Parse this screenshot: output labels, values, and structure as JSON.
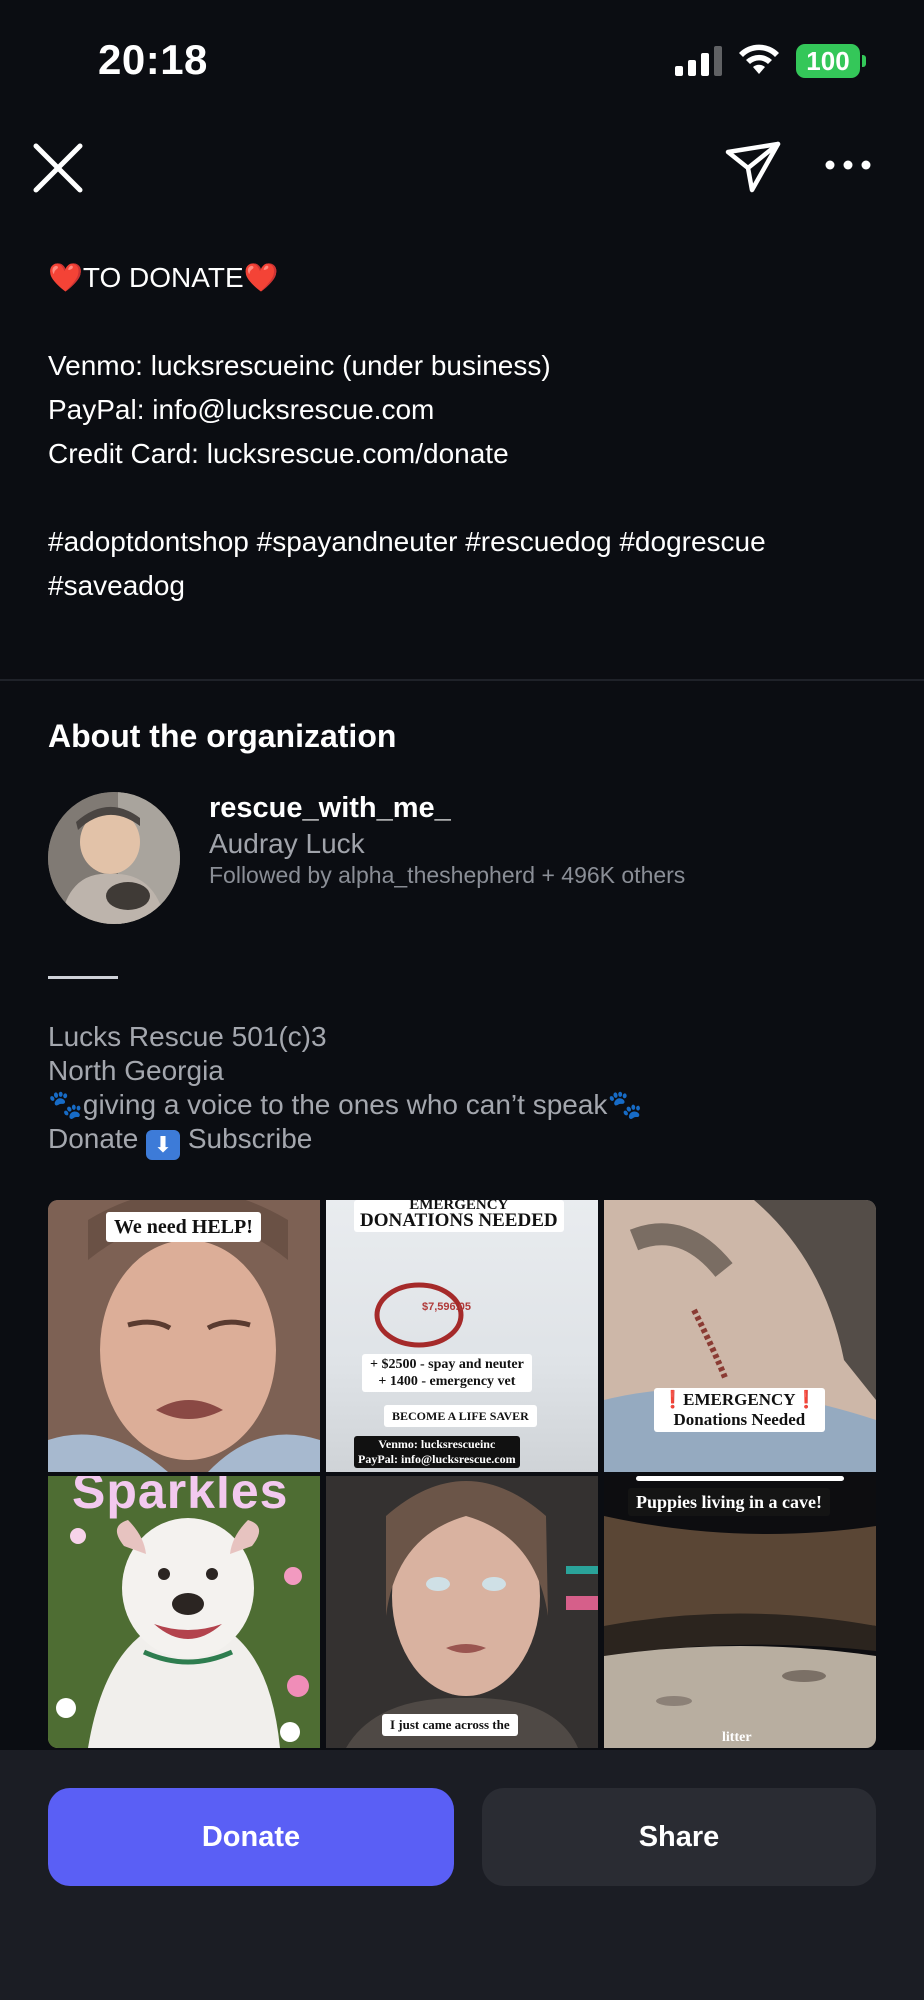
{
  "status_bar": {
    "time": "20:18",
    "battery": "100"
  },
  "caption": {
    "donate_heading": "TO DONATE",
    "venmo": "Venmo: lucksrescueinc (under business)",
    "paypal": "PayPal: info@lucksrescue.com",
    "credit_card": "Credit Card: lucksrescue.com/donate",
    "hashtags": "#adoptdontshop #spayandneuter #rescuedog #dogrescue #saveadog"
  },
  "about": {
    "heading": "About the organization",
    "handle": "rescue_with_me_",
    "name": "Audray Luck",
    "followers": "Followed by alpha_theshepherd + 496K others",
    "bio": {
      "line1": "Lucks Rescue 501(c)3",
      "line2": "North Georgia",
      "line3": "giving a voice to the ones who can’t speak",
      "line4_before": "Donate",
      "line4_after": "Subscribe"
    }
  },
  "grid": {
    "t1_label": "We need HELP!",
    "t2_header_top": "EMERGENCY",
    "t2_header": "DONATIONS NEEDED",
    "t2_balance": "$7,596.05",
    "t2_line1": "+ $2500 - spay and neuter",
    "t2_line2": "+ 1400 - emergency vet",
    "t2_line3": "BECOME A LIFE SAVER",
    "t2_venmo": "Venmo: lucksrescueinc",
    "t2_paypal": "PayPal: info@lucksrescue.com",
    "t3_label_1": "❗EMERGENCY❗",
    "t3_label_2": "Donations Needed",
    "t4_label": "Sparkles",
    "t5_label": "I just came across the",
    "t6_label": "Puppies living in a cave!",
    "t6_bottom": "litter"
  },
  "actions": {
    "donate": "Donate",
    "share": "Share"
  },
  "colors": {
    "primary": "#5a5ff5",
    "battery": "#34c759",
    "heart": "#e0332d"
  }
}
